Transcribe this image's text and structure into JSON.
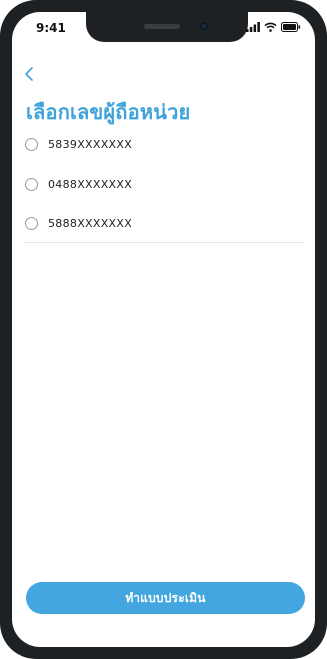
{
  "status_bar": {
    "time": "9:41",
    "icons": [
      "signal-icon",
      "wifi-icon",
      "battery-icon"
    ]
  },
  "header": {
    "back_icon": "chevron-left-icon",
    "title": "เลือกเลขผู้ถือหน่วย"
  },
  "options": [
    {
      "label": "5839XXXXXXX",
      "selected": false
    },
    {
      "label": "0488XXXXXXX",
      "selected": false
    },
    {
      "label": "5888XXXXXXX",
      "selected": false
    }
  ],
  "primary_button": {
    "label": "ทำแบบประเมิน"
  },
  "colors": {
    "accent": "#43a6e0",
    "title": "#3fa3db",
    "frame": "#1e2124"
  }
}
